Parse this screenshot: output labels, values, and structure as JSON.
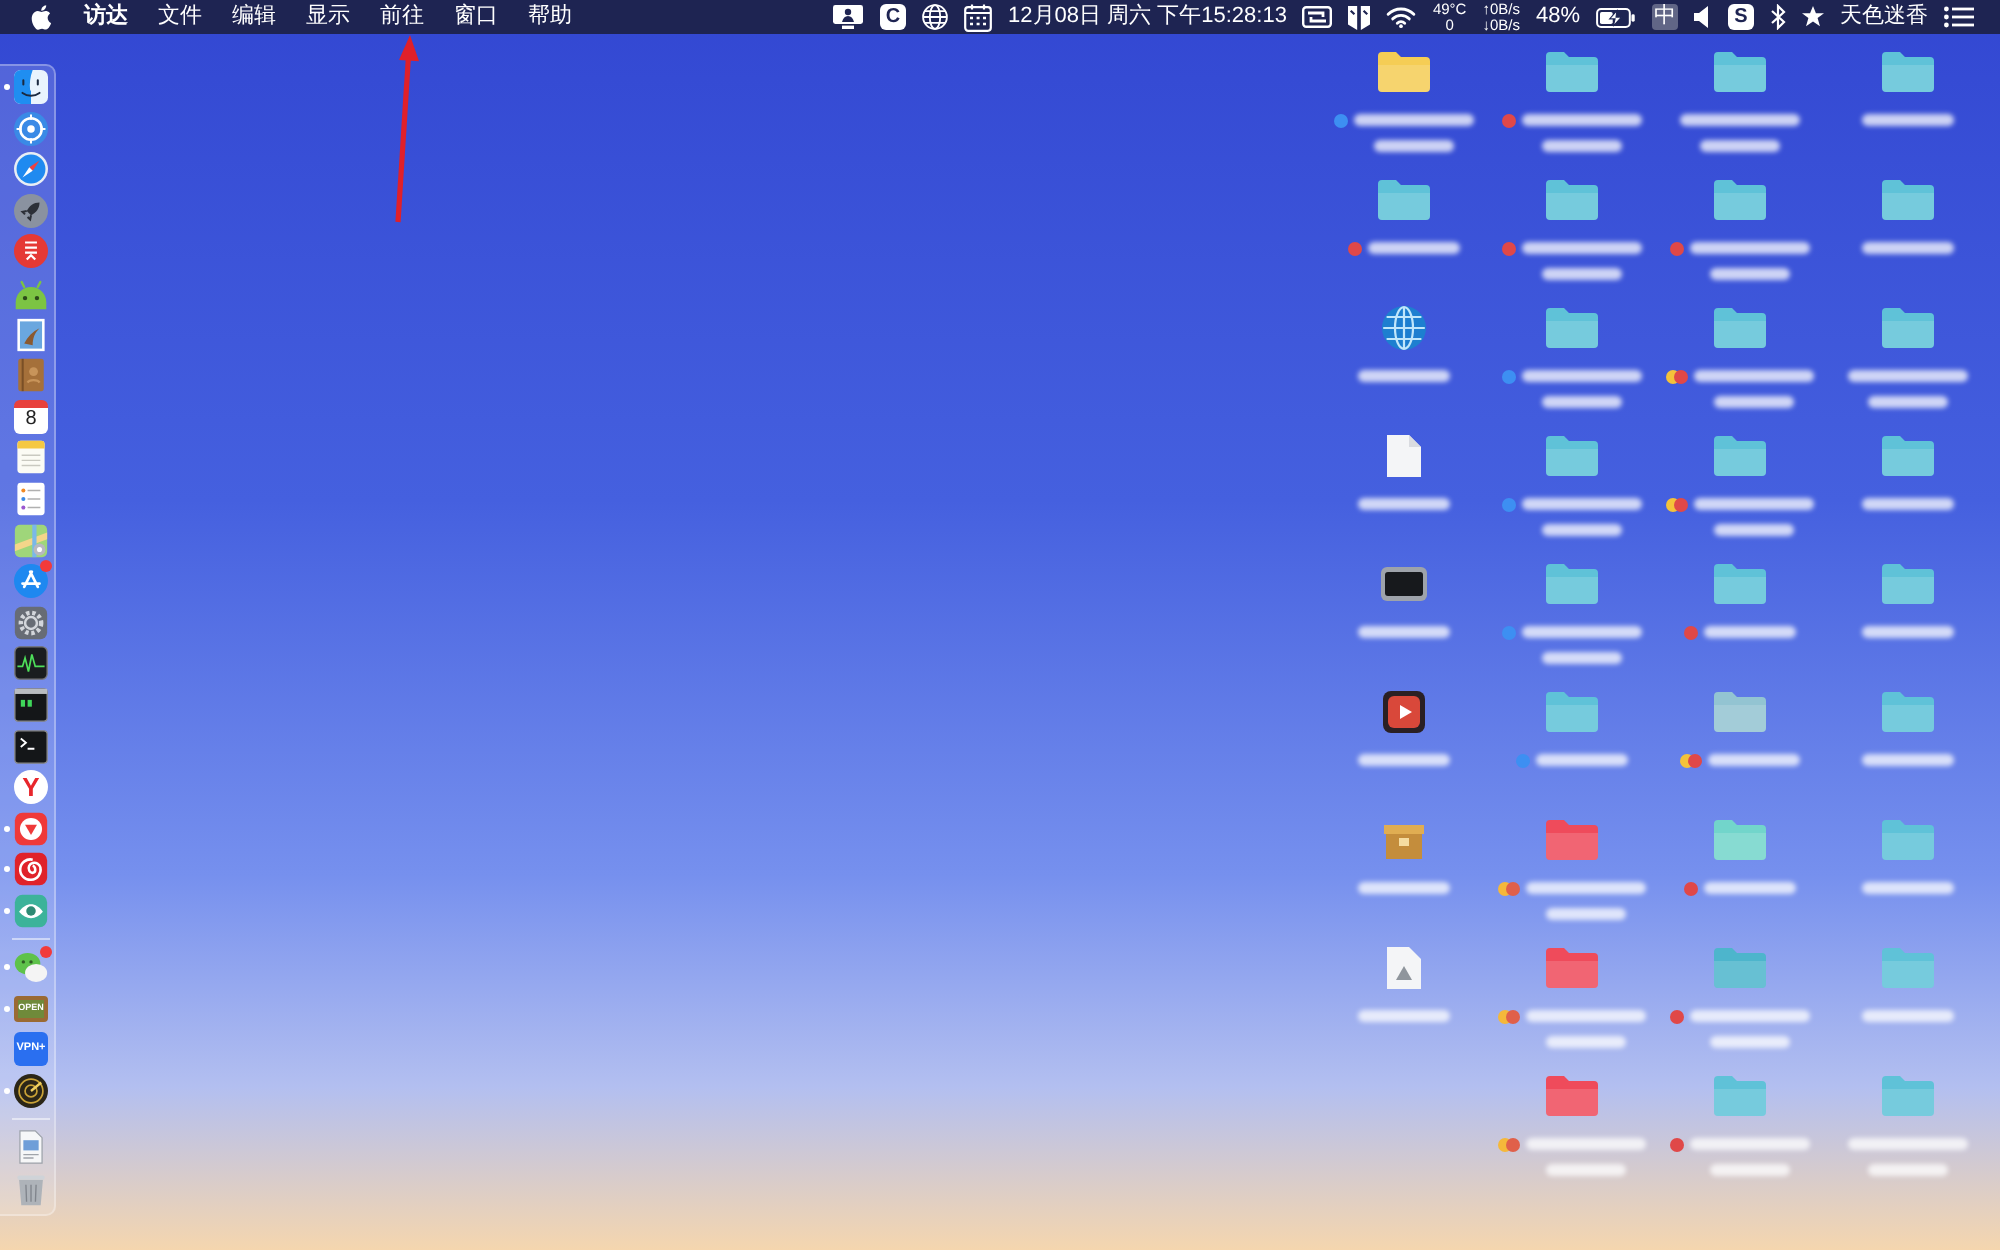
{
  "menu_bar": {
    "app_name": "访达",
    "menus": [
      "文件",
      "编辑",
      "显示",
      "前往",
      "窗口",
      "帮助"
    ],
    "extras": [
      {
        "kind": "display"
      },
      {
        "kind": "tile",
        "text": "C"
      },
      {
        "kind": "globe"
      },
      {
        "kind": "calendar"
      },
      {
        "kind": "clock",
        "text": "12月08日 周六 下午15:28:13"
      },
      {
        "kind": "toggle"
      },
      {
        "kind": "logo"
      },
      {
        "kind": "wifi"
      },
      {
        "kind": "sensor",
        "lines": [
          "49°C",
          "0"
        ]
      },
      {
        "kind": "sensor",
        "lines": [
          "↑0B/s",
          "↓0B/s"
        ]
      },
      {
        "kind": "percent",
        "text": "48%"
      },
      {
        "kind": "battery",
        "charging": true
      },
      {
        "kind": "input",
        "text": "中"
      },
      {
        "kind": "speaker"
      },
      {
        "kind": "tile",
        "text": "S"
      },
      {
        "kind": "bluetooth"
      },
      {
        "kind": "star"
      },
      {
        "kind": "user",
        "text": "天色迷香"
      },
      {
        "kind": "list"
      }
    ]
  },
  "dock": {
    "items": [
      {
        "kind": "finder",
        "running": true,
        "badge": false
      },
      {
        "kind": "ring",
        "running": false,
        "badge": false
      },
      {
        "kind": "compass",
        "running": false,
        "badge": false
      },
      {
        "kind": "rocket",
        "running": false,
        "badge": false
      },
      {
        "kind": "fan",
        "running": false,
        "badge": false
      },
      {
        "kind": "robot",
        "running": false,
        "badge": false
      },
      {
        "kind": "stamp",
        "running": false,
        "badge": false
      },
      {
        "kind": "book",
        "running": false,
        "badge": false
      },
      {
        "kind": "calendar",
        "text": "8",
        "running": false,
        "badge": false
      },
      {
        "kind": "notes",
        "running": false,
        "badge": false
      },
      {
        "kind": "checklist",
        "running": false,
        "badge": false
      },
      {
        "kind": "map",
        "running": false,
        "badge": false
      },
      {
        "kind": "store",
        "running": false,
        "badge": true
      },
      {
        "kind": "gear",
        "running": false,
        "badge": false
      },
      {
        "kind": "graph",
        "running": false,
        "badge": false
      },
      {
        "kind": "console",
        "running": false,
        "badge": false
      },
      {
        "kind": "terminal",
        "running": false,
        "badge": false
      },
      {
        "kind": "letter",
        "text": "Y",
        "running": false,
        "badge": false
      },
      {
        "kind": "notch",
        "running": true,
        "badge": false
      },
      {
        "kind": "swirl",
        "running": true,
        "badge": false
      },
      {
        "kind": "eye",
        "running": true,
        "badge": false
      },
      {
        "kind": "divider"
      },
      {
        "kind": "chat",
        "running": true,
        "badge": true
      },
      {
        "kind": "sign",
        "text": "OPEN",
        "running": true,
        "badge": false
      },
      {
        "kind": "vpn",
        "text": "VPN+",
        "running": false,
        "badge": false
      },
      {
        "kind": "radar",
        "running": true,
        "badge": false
      },
      {
        "kind": "divider"
      },
      {
        "kind": "file",
        "running": false,
        "badge": false
      },
      {
        "kind": "trash",
        "running": false,
        "badge": false
      }
    ]
  },
  "desktop": {
    "columns": [
      {
        "items": [
          {
            "kind": "folder",
            "color": "#f5cd55",
            "tags": [
              {
                "color": "#3d8ff2"
              }
            ],
            "label_wrapped": true
          },
          {
            "kind": "folder",
            "color": "#5fc2d8",
            "tags": [
              {
                "color": "#e04848"
              }
            ],
            "label_wrapped": false
          },
          {
            "kind": "globe",
            "label_wrapped": false
          },
          {
            "kind": "document",
            "label_wrapped": false
          },
          {
            "kind": "screen",
            "label_wrapped": false
          },
          {
            "kind": "player",
            "label_wrapped": false
          },
          {
            "kind": "box",
            "label_wrapped": false
          },
          {
            "kind": "file",
            "label_wrapped": false
          }
        ]
      },
      {
        "items": [
          {
            "kind": "folder",
            "color": "#5fc2d8",
            "tags": [
              {
                "color": "#e04848"
              }
            ],
            "label_wrapped": true
          },
          {
            "kind": "folder",
            "color": "#5fc2d8",
            "tags": [
              {
                "color": "#e04848"
              }
            ],
            "label_wrapped": true
          },
          {
            "kind": "folder",
            "color": "#5fc2d8",
            "tags": [
              {
                "color": "#3d8ff2"
              }
            ],
            "label_wrapped": true
          },
          {
            "kind": "folder",
            "color": "#5fc2d8",
            "tags": [
              {
                "color": "#3d8ff2"
              }
            ],
            "label_wrapped": true
          },
          {
            "kind": "folder",
            "color": "#5fc2d8",
            "tags": [
              {
                "color": "#3d8ff2"
              }
            ],
            "label_wrapped": true
          },
          {
            "kind": "folder",
            "color": "#5fc2d8",
            "tags": [
              {
                "color": "#3d8ff2"
              }
            ],
            "label_wrapped": false
          },
          {
            "kind": "folder",
            "color": "#ef4b5b",
            "tags": [
              {
                "color": "#f5b83a"
              },
              {
                "color": "#e0604a"
              }
            ],
            "label_wrapped": true
          },
          {
            "kind": "folder",
            "color": "#ef4b5b",
            "tags": [
              {
                "color": "#f5b83a"
              },
              {
                "color": "#e0604a"
              }
            ],
            "label_wrapped": true
          },
          {
            "kind": "folder",
            "color": "#ef4b5b",
            "tags": [
              {
                "color": "#f5b83a"
              },
              {
                "color": "#e0604a"
              }
            ],
            "label_wrapped": true
          }
        ]
      },
      {
        "items": [
          {
            "kind": "folder",
            "color": "#5fc2d8",
            "label_wrapped": true
          },
          {
            "kind": "folder",
            "color": "#5fc2d8",
            "tags": [
              {
                "color": "#e04848"
              }
            ],
            "label_wrapped": true
          },
          {
            "kind": "folder",
            "color": "#5fc2d8",
            "tags": [
              {
                "color": "#f4c23a"
              },
              {
                "color": "#e04848"
              }
            ],
            "label_wrapped": true
          },
          {
            "kind": "folder",
            "color": "#5fc2d8",
            "tags": [
              {
                "color": "#f4c23a"
              },
              {
                "color": "#e04848"
              }
            ],
            "label_wrapped": true
          },
          {
            "kind": "folder",
            "color": "#5fc2d8",
            "tags": [
              {
                "color": "#e04848"
              }
            ],
            "label_wrapped": false
          },
          {
            "kind": "folder",
            "color": "#93c4d2",
            "tags": [
              {
                "color": "#f4c23a"
              },
              {
                "color": "#e04848"
              }
            ],
            "label_wrapped": false
          },
          {
            "kind": "folder",
            "color": "#72d5cb",
            "tags": [
              {
                "color": "#e04848"
              }
            ],
            "label_wrapped": false
          },
          {
            "kind": "folder",
            "color": "#4db5cc",
            "tags": [
              {
                "color": "#e04848"
              }
            ],
            "label_wrapped": true
          },
          {
            "kind": "folder",
            "color": "#5fc2d8",
            "tags": [
              {
                "color": "#e04848"
              }
            ],
            "label_wrapped": true
          }
        ]
      },
      {
        "items": [
          {
            "kind": "folder",
            "color": "#5fc2d8",
            "label_wrapped": false
          },
          {
            "kind": "folder",
            "color": "#5fc2d8",
            "label_wrapped": false
          },
          {
            "kind": "folder",
            "color": "#5fc2d8",
            "label_wrapped": true
          },
          {
            "kind": "folder",
            "color": "#5fc2d8",
            "label_wrapped": false
          },
          {
            "kind": "folder",
            "color": "#5fc2d8",
            "label_wrapped": false
          },
          {
            "kind": "folder",
            "color": "#5fc2d8",
            "label_wrapped": false
          },
          {
            "kind": "folder",
            "color": "#5fc2d8",
            "label_wrapped": false
          },
          {
            "kind": "folder",
            "color": "#5fc2d8",
            "label_wrapped": false
          },
          {
            "kind": "folder",
            "color": "#5fc2d8",
            "label_wrapped": true
          }
        ]
      }
    ]
  }
}
